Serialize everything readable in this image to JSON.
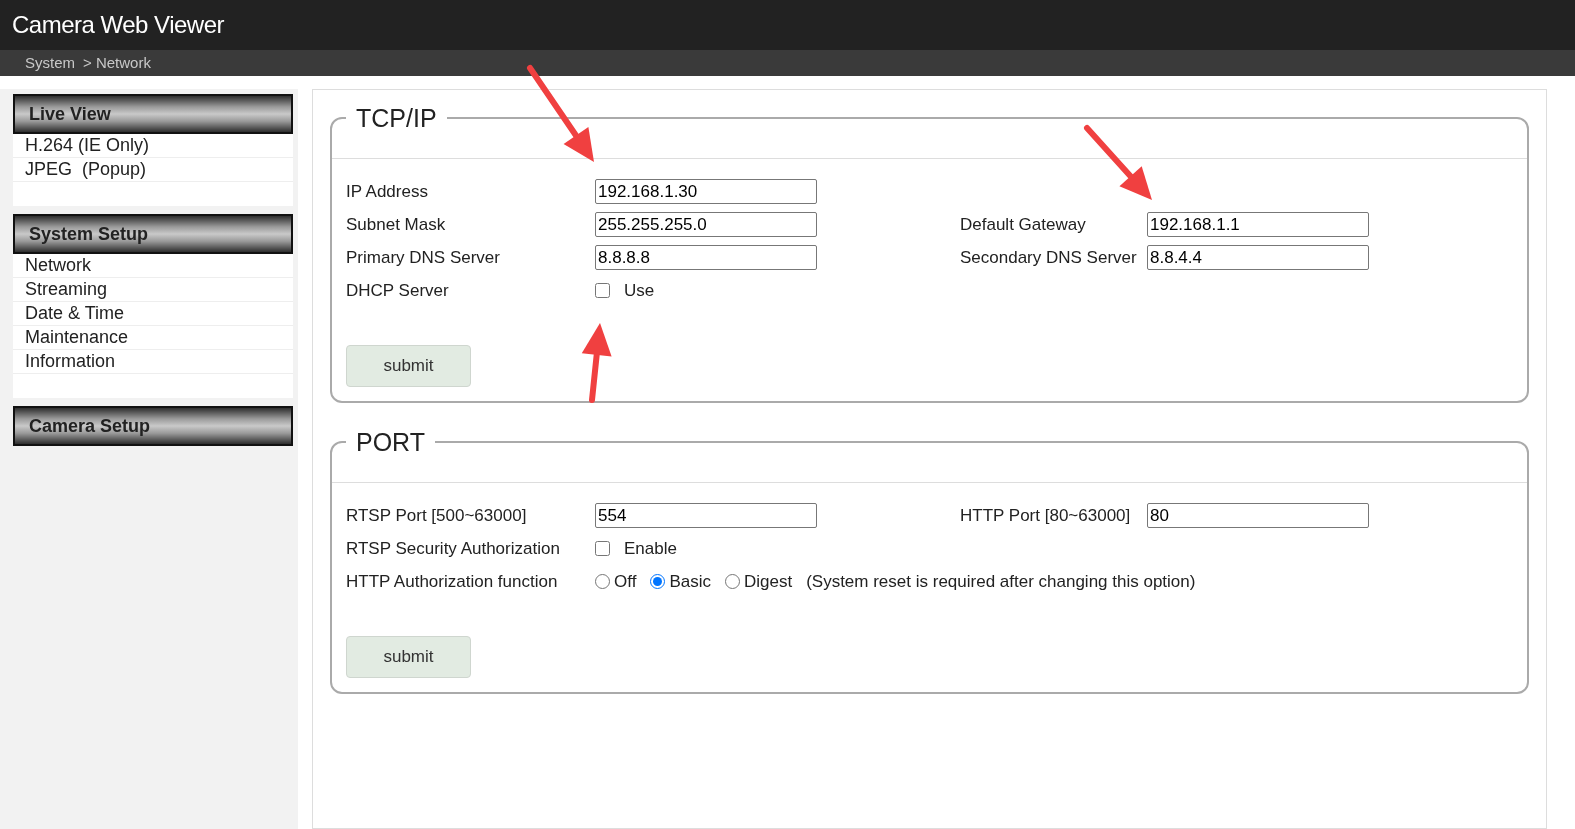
{
  "header": {
    "title": "Camera Web Viewer"
  },
  "breadcrumb": [
    "System",
    "> Network"
  ],
  "sidebar": [
    {
      "heading": "Live View",
      "items": [
        {
          "label": "H.264 (IE Only)"
        },
        {
          "label": "JPEG  (Popup)"
        }
      ]
    },
    {
      "heading": "System Setup",
      "items": [
        {
          "label": "Network"
        },
        {
          "label": "Streaming"
        },
        {
          "label": "Date & Time"
        },
        {
          "label": "Maintenance"
        },
        {
          "label": "Information"
        }
      ]
    },
    {
      "heading": "Camera Setup"
    }
  ],
  "sections": [
    {
      "title": "TCP/IP",
      "rows": [
        {
          "label": "IP Address",
          "control": {
            "kind": "text",
            "value": "192.168.1.30"
          }
        },
        {
          "label": "Subnet Mask",
          "control": {
            "kind": "text",
            "value": "255.255.255.0"
          },
          "right": {
            "label": "Default Gateway",
            "value": "192.168.1.1"
          }
        },
        {
          "label": "Primary DNS Server",
          "control": {
            "kind": "text",
            "value": "8.8.8.8"
          },
          "right": {
            "label": "Secondary DNS Server",
            "value": "8.8.4.4"
          }
        },
        {
          "label": "DHCP Server",
          "control": {
            "kind": "checkbox",
            "checked": false,
            "label": "Use"
          }
        }
      ],
      "submit": "submit"
    },
    {
      "title": "PORT",
      "rows": [
        {
          "label": "RTSP Port [500~63000]",
          "control": {
            "kind": "text",
            "value": "554"
          },
          "right": {
            "label": "HTTP Port [80~63000]",
            "value": "80"
          }
        },
        {
          "label": "RTSP Security Authorization",
          "control": {
            "kind": "checkbox",
            "checked": false,
            "label": "Enable"
          }
        },
        {
          "label": "HTTP Authorization function",
          "control": {
            "kind": "radio",
            "options": [
              {
                "label": "Off",
                "selected": false
              },
              {
                "label": "Basic",
                "selected": true
              },
              {
                "label": "Digest",
                "selected": false
              }
            ],
            "note": "(System reset is required after changing this option)"
          }
        }
      ],
      "submit": "submit"
    }
  ]
}
